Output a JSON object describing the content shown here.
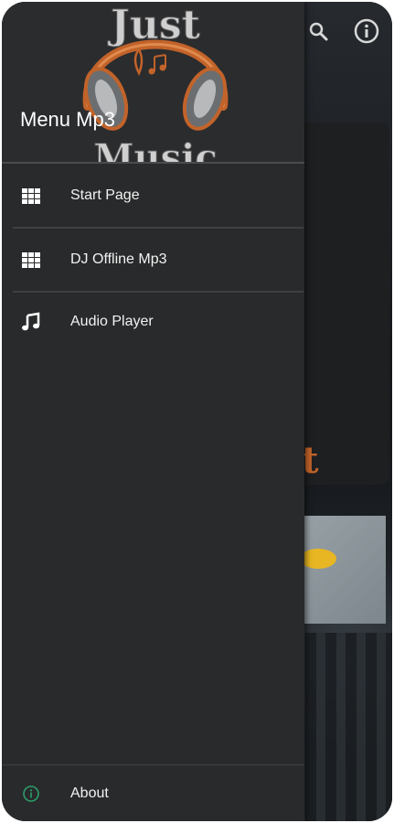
{
  "colors": {
    "drawer_bg": "#282a2b",
    "header_bg": "#2b2c2e",
    "text": "#f2f2f2",
    "about_icon": "#2e9d6b",
    "logo_orange": "#c2632a"
  },
  "drawer": {
    "logo_text_line1": "Just",
    "logo_text_line2": "Music",
    "title": "Menu Mp3",
    "items": [
      {
        "label": "Start Page",
        "icon": "grid-icon"
      },
      {
        "label": "DJ Offline Mp3",
        "icon": "grid-icon"
      },
      {
        "label": "Audio Player",
        "icon": "music-note-icon"
      }
    ],
    "footer": {
      "label": "About",
      "icon": "info-icon"
    }
  },
  "background_app": {
    "toolbar_icons": [
      "search-icon",
      "info-icon"
    ],
    "card_text": "t"
  }
}
